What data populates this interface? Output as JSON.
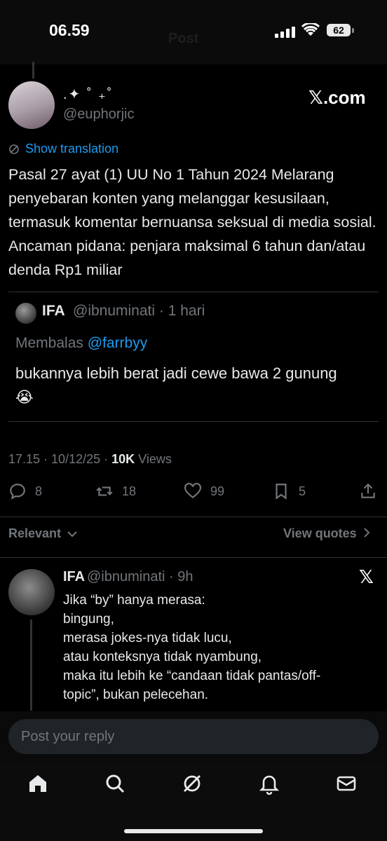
{
  "status_bar": {
    "time": "06.59",
    "battery": "62"
  },
  "ghost_header": "Post",
  "post": {
    "display_name": ".✦ ˚ ₊˚",
    "handle": "@euphorjic",
    "brand": "𝕏.com",
    "translation_label": "Show translation",
    "text": "Pasal 27 ayat (1) UU No 1 Tahun 2024 Melarang penyebaran konten yang melanggar kesusilaan, termasuk komentar bernuansa seksual di media sosial. Ancaman pidana: penjara maksimal 6 tahun dan/atau denda Rp1 miliar",
    "quote": {
      "name": "IFA",
      "handle_time": "@ibnuminati · 1 hari",
      "replying_prefix": "Membalas ",
      "replying_to": "@farrbyy",
      "text": "bukannya lebih berat jadi cewe bawa 2 gunung 😭"
    },
    "meta": {
      "time_date": "17.15 · 10/12/25 · ",
      "views_count": "10K",
      "views_label": " Views"
    },
    "actions": {
      "replies": "8",
      "reposts": "18",
      "likes": "99",
      "bookmarks": "5"
    }
  },
  "sort": {
    "label": "Relevant",
    "view_quotes": "View quotes"
  },
  "reply": {
    "name": "IFA",
    "handle_time": "@ibnuminati · 9h",
    "x_icon": "𝕏",
    "lines": [
      "Jika “by” hanya merasa:",
      "bingung,",
      "merasa jokes-nya tidak lucu,",
      "atau konteksnya tidak nyambung,",
      "maka itu lebih ke “candaan tidak pantas/off-",
      "topic”, bukan pelecehan."
    ]
  },
  "compose": {
    "placeholder": "Post your reply"
  },
  "icons": [
    "signal-icon",
    "wifi-icon",
    "battery-icon",
    "translate-icon",
    "reply-icon",
    "repost-icon",
    "like-icon",
    "bookmark-icon",
    "share-icon",
    "chevron-down-icon",
    "chevron-right-icon",
    "home-icon",
    "search-icon",
    "grok-icon",
    "bell-icon",
    "mail-icon"
  ],
  "colors": {
    "accent": "#1d9bf0",
    "muted": "#71767b",
    "text": "#e7e9ea",
    "background": "#000000"
  }
}
